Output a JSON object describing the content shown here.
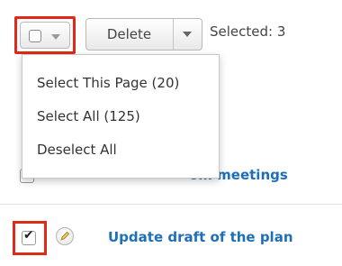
{
  "toolbar": {
    "delete_label": "Delete",
    "selected_text": "Selected: 3"
  },
  "menu": {
    "items": [
      {
        "label": "Select This Page (20)"
      },
      {
        "label": "Select All (125)"
      },
      {
        "label": "Deselect All"
      }
    ]
  },
  "rows": [
    {
      "title": "om meetings",
      "checked": false
    },
    {
      "title": "Update draft of the plan",
      "checked": true
    }
  ],
  "colors": {
    "highlight": "#e02a16",
    "link": "#1d6fb8"
  }
}
